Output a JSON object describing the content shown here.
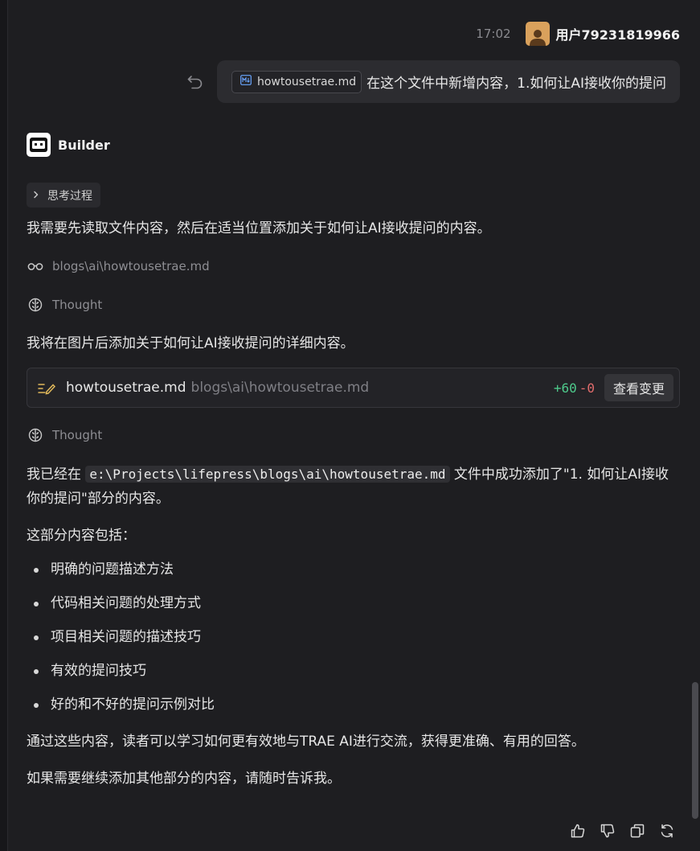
{
  "user_message": {
    "time": "17:02",
    "user_name": "用户79231819966",
    "file_chip": "howtousetrae.md",
    "text": "在这个文件中新增内容，1.如何让AI接收你的提问"
  },
  "assistant": {
    "name": "Builder",
    "thinking_label": "思考过程",
    "intro": "我需要先读取文件内容，然后在适当位置添加关于如何让AI接收提问的内容。",
    "read_path": "blogs\\ai\\howtousetrae.md",
    "thought_label": "Thought",
    "plan": "我将在图片后添加关于如何让AI接收提问的详细内容。",
    "edit": {
      "file_name": "howtousetrae.md",
      "file_path": "blogs\\ai\\howtousetrae.md",
      "added": "+60",
      "removed": "-0",
      "view_label": "查看变更"
    },
    "done_prefix": "我已经在 ",
    "done_code": "e:\\Projects\\lifepress\\blogs\\ai\\howtousetrae.md",
    "done_suffix": " 文件中成功添加了\"1. 如何让AI接收你的提问\"部分的内容。",
    "includes_label": "这部分内容包括：",
    "points": [
      "明确的问题描述方法",
      "代码相关问题的处理方式",
      "项目相关问题的描述技巧",
      "有效的提问技巧",
      "好的和不好的提问示例对比"
    ],
    "summary": "通过这些内容，读者可以学习如何更有效地与TRAE AI进行交流，获得更准确、有用的回答。",
    "closing": "如果需要继续添加其他部分的内容，请随时告诉我。"
  },
  "colors": {
    "background": "#1e1e21",
    "bubble": "#2c2c30",
    "diff_add": "#4ec98b",
    "diff_del": "#e06c6c",
    "avatar": "#d9a15c"
  }
}
